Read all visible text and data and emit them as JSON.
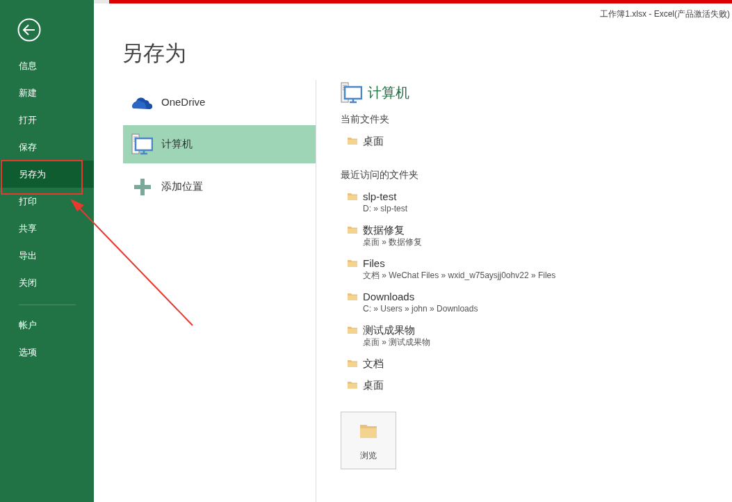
{
  "window": {
    "title": "工作簿1.xlsx - Excel(产品激活失败)"
  },
  "sidebar": {
    "items": [
      {
        "label": "信息",
        "selected": false
      },
      {
        "label": "新建",
        "selected": false
      },
      {
        "label": "打开",
        "selected": false
      },
      {
        "label": "保存",
        "selected": false
      },
      {
        "label": "另存为",
        "selected": true
      },
      {
        "label": "打印",
        "selected": false
      },
      {
        "label": "共享",
        "selected": false
      },
      {
        "label": "导出",
        "selected": false
      },
      {
        "label": "关闭",
        "selected": false
      }
    ],
    "bottom_items": [
      {
        "label": "帐户",
        "selected": false
      },
      {
        "label": "选项",
        "selected": false
      }
    ]
  },
  "page_title": "另存为",
  "places": [
    {
      "kind": "cloud",
      "label": "OneDrive",
      "selected": false
    },
    {
      "kind": "computer",
      "label": "计算机",
      "selected": true
    },
    {
      "kind": "add",
      "label": "添加位置",
      "selected": false
    }
  ],
  "detail": {
    "heading": "计算机",
    "current": {
      "label": "当前文件夹",
      "folders": [
        {
          "name": "桌面"
        }
      ]
    },
    "recent": {
      "label": "最近访问的文件夹",
      "folders": [
        {
          "name": "slp-test",
          "path": "D: » slp-test"
        },
        {
          "name": "数据修复",
          "path": "桌面 » 数据修复"
        },
        {
          "name": "Files",
          "path": "文档 » WeChat Files » wxid_w75aysjj0ohv22 » Files"
        },
        {
          "name": "Downloads",
          "path": "C: » Users » john » Downloads"
        },
        {
          "name": "测试成果物",
          "path": "桌面 » 测试成果物"
        },
        {
          "name": "文档"
        },
        {
          "name": "桌面"
        }
      ]
    },
    "browse_button": "浏览"
  }
}
